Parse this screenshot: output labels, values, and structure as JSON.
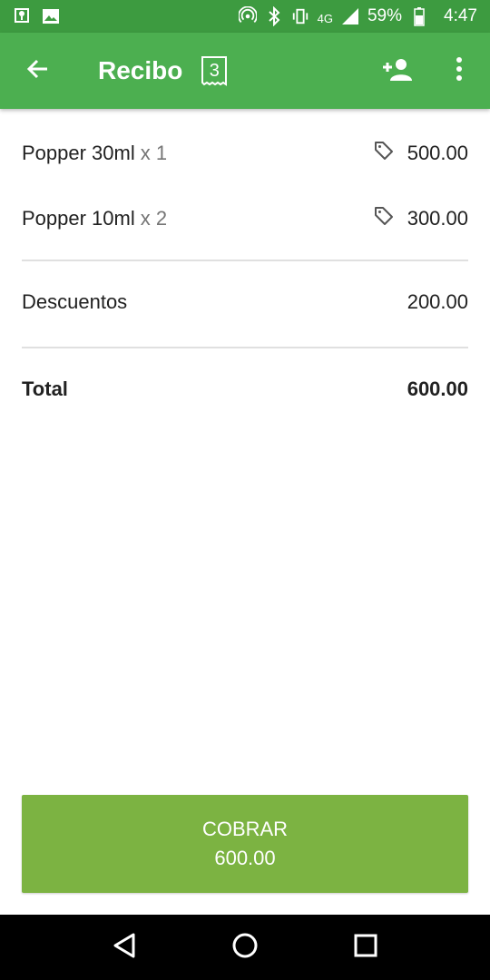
{
  "status_bar": {
    "network": "4G",
    "battery": "59%",
    "time": "4:47"
  },
  "app_bar": {
    "title": "Recibo",
    "receipt_count": "3",
    "icons": [
      "back-arrow-icon",
      "receipt-icon",
      "add-customer-icon",
      "more-vert-icon"
    ]
  },
  "items": [
    {
      "name": "Popper 30ml",
      "qty": "x 1",
      "price": "500.00"
    },
    {
      "name": "Popper 10ml",
      "qty": "x 2",
      "price": "300.00"
    }
  ],
  "discounts": {
    "label": "Descuentos",
    "value": "200.00"
  },
  "total": {
    "label": "Total",
    "value": "600.00"
  },
  "charge_button": {
    "label": "COBRAR",
    "amount": "600.00"
  },
  "colors": {
    "status_bar": "#3d9b40",
    "app_bar": "#4caf50",
    "charge_button": "#7cb342"
  }
}
